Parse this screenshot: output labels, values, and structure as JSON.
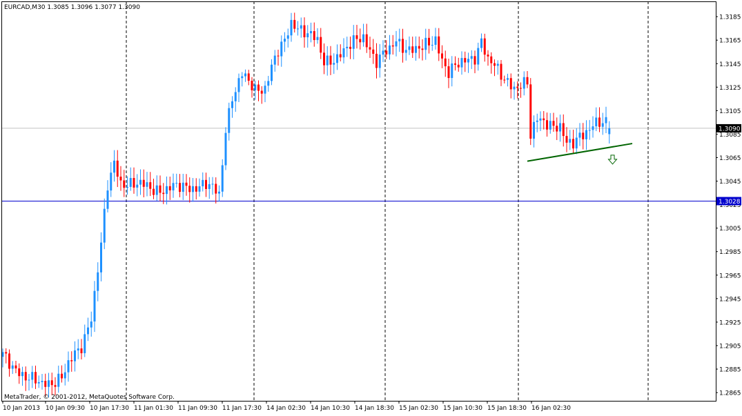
{
  "header": {
    "symbol_line": "EURCAD,M30  1.3085 1.3096 1.3077 1.3090"
  },
  "footer": {
    "copyright": "MetaTrader, © 2001-2012, MetaQuotes Software Corp."
  },
  "colors": {
    "bull": "#1e90ff",
    "bear": "#ff0000",
    "trendline": "#006400",
    "arrow": "#006400",
    "hline": "#0000cd",
    "bidline": "#c0c0c0",
    "axis": "#000000"
  },
  "chart_data": {
    "type": "candlestick",
    "symbol": "EURCAD",
    "timeframe": "M30",
    "last_ohlc": {
      "open": 1.3085,
      "high": 1.3096,
      "low": 1.3077,
      "close": 1.309
    },
    "ylim": [
      1.2858,
      1.3198
    ],
    "y_ticks": [
      "1.3185",
      "1.3165",
      "1.3145",
      "1.3125",
      "1.3105",
      "1.3085",
      "1.3065",
      "1.3045",
      "1.3025",
      "1.3005",
      "1.2985",
      "1.2965",
      "1.2945",
      "1.2925",
      "1.2905",
      "1.2885",
      "1.2865"
    ],
    "x_ticks": [
      "10 Jan 2013",
      "10 Jan 09:30",
      "10 Jan 17:30",
      "11 Jan 01:30",
      "11 Jan 09:30",
      "11 Jan 17:30",
      "14 Jan 02:30",
      "14 Jan 10:30",
      "14 Jan 18:30",
      "15 Jan 02:30",
      "15 Jan 10:30",
      "15 Jan 18:30",
      "16 Jan 02:30"
    ],
    "current_price": {
      "value": 1.309,
      "label": "1.3090"
    },
    "horizontal_line": {
      "value": 1.3028,
      "label": "1.3028"
    },
    "trendline": {
      "from": [
        160,
        1.3062
      ],
      "to": [
        192,
        1.3077
      ]
    },
    "arrow": {
      "bar": 186,
      "price": 1.3063,
      "direction": "down"
    },
    "anchors": [
      [
        0,
        1.2896
      ],
      [
        8,
        1.2876
      ],
      [
        12,
        1.2872
      ],
      [
        18,
        1.2878
      ],
      [
        20,
        1.2888
      ],
      [
        24,
        1.2905
      ],
      [
        27,
        1.293
      ],
      [
        30,
        1.299
      ],
      [
        32,
        1.304
      ],
      [
        34,
        1.306
      ],
      [
        36,
        1.3045
      ],
      [
        40,
        1.3042
      ],
      [
        48,
        1.3038
      ],
      [
        56,
        1.304
      ],
      [
        62,
        1.3042
      ],
      [
        66,
        1.3033
      ],
      [
        68,
        1.309
      ],
      [
        70,
        1.3118
      ],
      [
        73,
        1.3135
      ],
      [
        77,
        1.3122
      ],
      [
        80,
        1.3126
      ],
      [
        82,
        1.3143
      ],
      [
        84,
        1.3155
      ],
      [
        86,
        1.3162
      ],
      [
        88,
        1.318
      ],
      [
        92,
        1.3174
      ],
      [
        96,
        1.3163
      ],
      [
        98,
        1.3145
      ],
      [
        102,
        1.3152
      ],
      [
        106,
        1.316
      ],
      [
        110,
        1.3168
      ],
      [
        114,
        1.3148
      ],
      [
        118,
        1.3156
      ],
      [
        120,
        1.3164
      ],
      [
        124,
        1.3158
      ],
      [
        128,
        1.3157
      ],
      [
        132,
        1.3166
      ],
      [
        134,
        1.315
      ],
      [
        136,
        1.3138
      ],
      [
        140,
        1.3145
      ],
      [
        144,
        1.3152
      ],
      [
        146,
        1.3165
      ],
      [
        148,
        1.3148
      ],
      [
        152,
        1.3135
      ],
      [
        156,
        1.3126
      ],
      [
        160,
        1.3127
      ],
      [
        161,
        1.3082
      ],
      [
        163,
        1.3098
      ],
      [
        165,
        1.3098
      ],
      [
        168,
        1.3092
      ],
      [
        170,
        1.309
      ],
      [
        172,
        1.3075
      ],
      [
        174,
        1.3078
      ],
      [
        176,
        1.3085
      ],
      [
        180,
        1.3092
      ],
      [
        184,
        1.3094
      ],
      [
        185,
        1.309
      ]
    ]
  }
}
